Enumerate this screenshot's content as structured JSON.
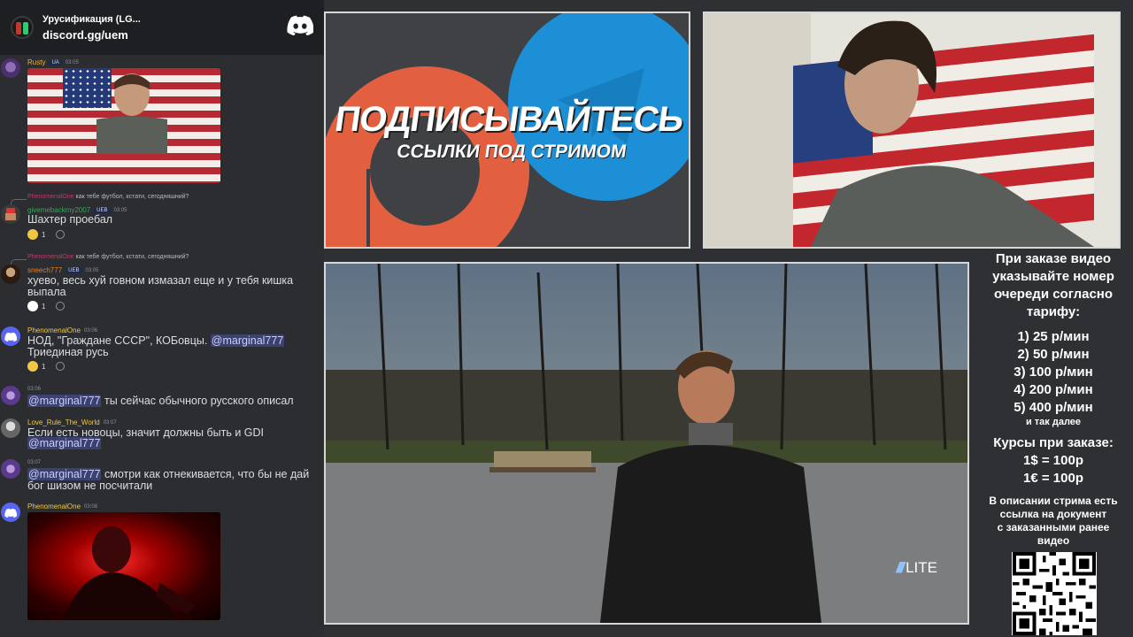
{
  "server": {
    "name": "Урусификация (LG...",
    "invite": "discord.gg/uem",
    "logo_icon": "discord-logo-icon"
  },
  "messages": [
    {
      "user": "Rusty",
      "user_color": "#e8b34a",
      "flag_tag": "UA",
      "time": "03:05",
      "avatar_icon": "user-avatar-icon",
      "embed": "image"
    },
    {
      "reply_user": "PhenomenalOne",
      "reply_text": "как тебе футбол, кстати, сегодняшний?",
      "user": "givemebackmy2007",
      "user_color": "#3ba55d",
      "tag": "UEB",
      "time": "03:05",
      "text": "Шахтер проебал",
      "reaction_count": "1",
      "reaction_color": "#f2c744"
    },
    {
      "reply_user": "PhenomenalOne",
      "reply_text": "как тебе футбол, кстати, сегодняшний?",
      "user": "sneech777",
      "user_color": "#e67e22",
      "tag": "UEB",
      "time": "03:05",
      "text_line1": "хуево, весь хуй говном измазал еще и у тебя кишка",
      "text_line2": "выпала",
      "reaction_count": "1",
      "reaction_color": "#ffffff"
    },
    {
      "user": "PhenomenalOne",
      "user_color": "#f2c744",
      "time": "03:06",
      "text_line1": "НОД, \"Граждане СССР\", КОБовцы.",
      "mention": "@marginal777",
      "text_line2": "Триединая русь",
      "reaction_count": "1",
      "reaction_color": "#f2c744"
    },
    {
      "time": "03:06",
      "mention": "@marginal777",
      "text": "ты сейчас обычного русского описал"
    },
    {
      "user": "Love_Rule_The_World",
      "user_color": "#f2c744",
      "time": "03:07",
      "text_line1": "Если есть новоцы, значит должны быть и GDI",
      "mention": "@marginal777"
    },
    {
      "time": "03:07",
      "mention": "@marginal777",
      "text_line1": "смотри как отнекивается, что бы не дай",
      "text_line2": "бог шизом не посчитали"
    },
    {
      "user": "PhenomenalOne",
      "user_color": "#f2c744",
      "time": "03:08",
      "embed": "image"
    }
  ],
  "promo": {
    "line1": "ПОДПИСЫВАЙТЕСЬ",
    "line2": "ССЫЛКИ ПОД СТРИМОМ"
  },
  "video": {
    "badge": "LITE"
  },
  "info": {
    "heading": [
      "При заказе видео",
      "указывайте номер",
      "очереди согласно",
      "тарифу:"
    ],
    "tariffs": [
      "1) 25 р/мин",
      "2) 50 р/мин",
      "3) 100 р/мин",
      "4) 200 р/мин",
      "5) 400 р/мин"
    ],
    "etc": "и так далее",
    "rates_title": "Курсы при заказе:",
    "rates": [
      "1$ = 100р",
      "1€ = 100р"
    ],
    "doc": [
      "В описании стрима есть",
      "ссылка на документ",
      "с заказанными ранее",
      "видео"
    ]
  }
}
